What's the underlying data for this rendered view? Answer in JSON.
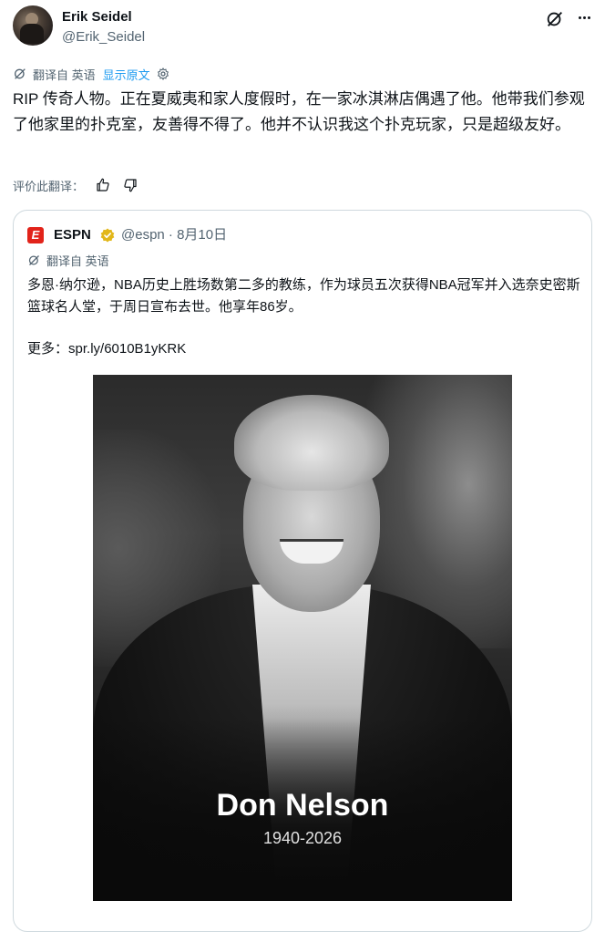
{
  "author": {
    "display_name": "Erik Seidel",
    "handle": "@Erik_Seidel"
  },
  "translation_bar": {
    "label": "翻译自 英语",
    "show_original": "显示原文"
  },
  "tweet": {
    "text": "RIP 传奇人物。正在夏威夷和家人度假时，在一家冰淇淋店偶遇了他。他带我们参观了他家里的扑克室，友善得不得了。他并不认识我这个扑克玩家，只是超级友好。"
  },
  "rate_translation": {
    "label": "评价此翻译："
  },
  "quote": {
    "name": "ESPN",
    "logo_letter": "E",
    "meta": "@espn · 8月10日",
    "translation_label": "翻译自 英语",
    "text": "多恩·纳尔逊，NBA历史上胜场数第二多的教练，作为球员五次获得NBA冠军并入选奈史密斯篮球名人堂，于周日宣布去世。他享年86岁。",
    "more_label": "更多：",
    "link": "spr.ly/6010B1yKRK",
    "image": {
      "name_caption": "Don Nelson",
      "years_caption": "1940-2026"
    }
  },
  "colors": {
    "accent": "#1d9bf0",
    "secondary_text": "#536471",
    "espn_red": "#e2231a",
    "verified_gold": "#e2b719"
  }
}
